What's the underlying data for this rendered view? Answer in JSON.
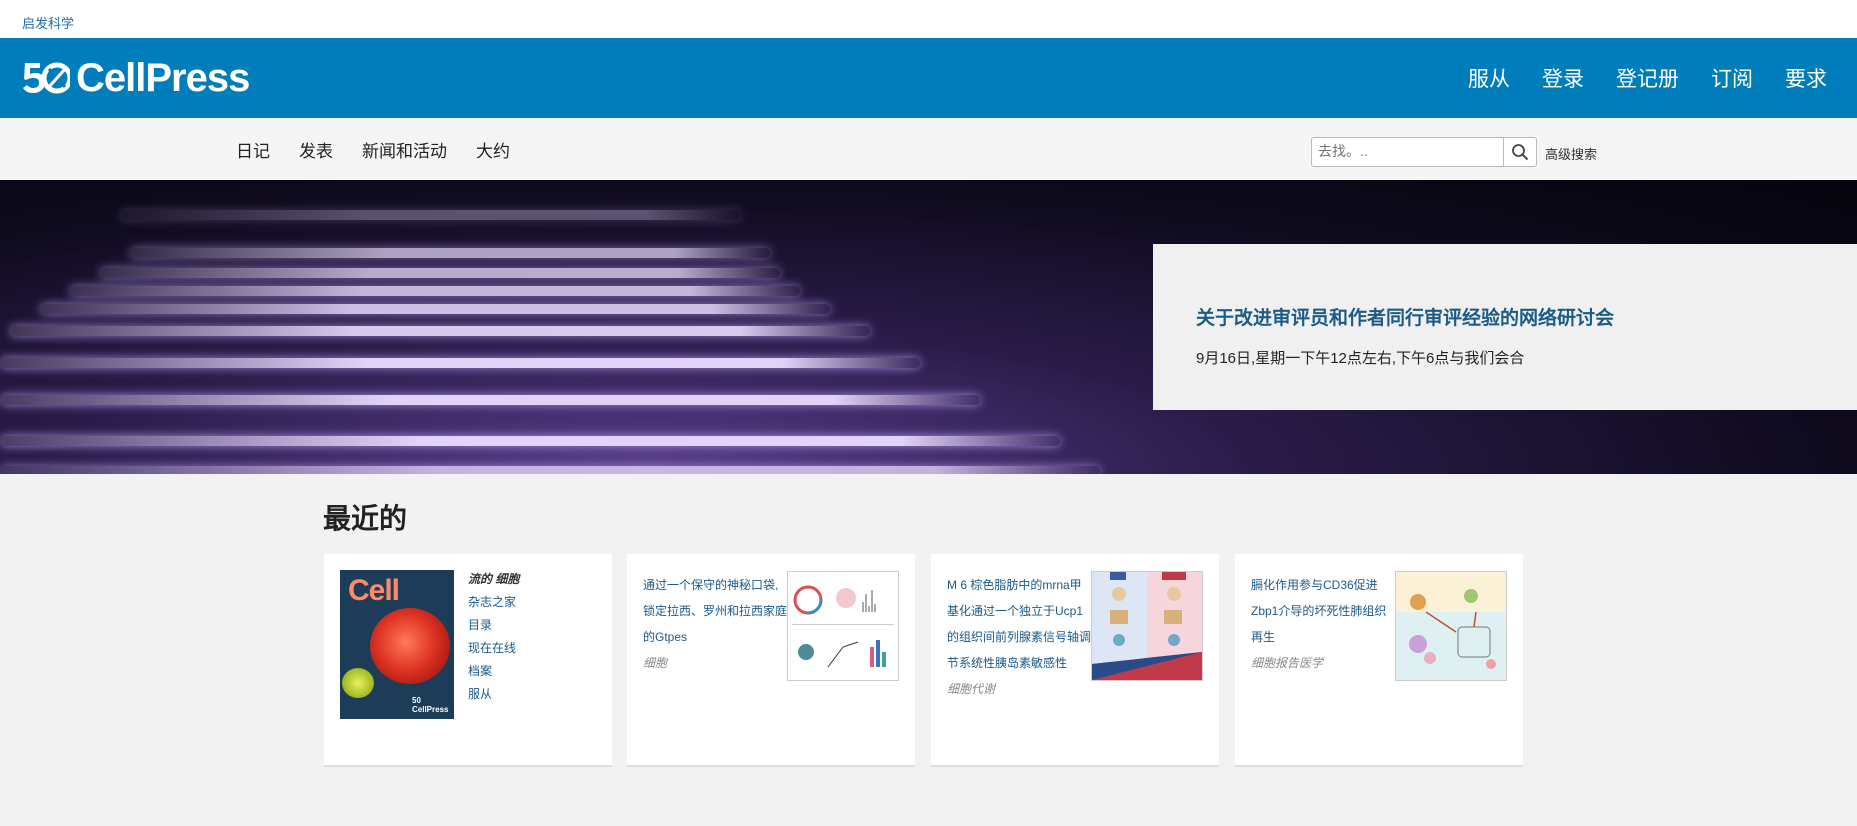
{
  "topbar": {
    "link": "启发科学"
  },
  "header": {
    "logo_number": "50",
    "logo_text": "CellPress",
    "nav": [
      "服从",
      "登录",
      "登记册",
      "订阅",
      "要求"
    ]
  },
  "subnav": {
    "items": [
      "日记",
      "发表",
      "新闻和活动",
      "大约"
    ],
    "search_placeholder": "去找。..",
    "advanced_search": "高级搜索"
  },
  "hero": {
    "title": "关于改进审评员和作者同行审评经验的网络研讨会",
    "subtitle": "9月16日,星期一下午12点左右,下午6点与我们会合"
  },
  "recent": {
    "heading": "最近的",
    "card1": {
      "cover_title": "Cell",
      "cover_brand": "50 CellPress",
      "links": [
        "流的 细胞",
        "杂志之家",
        "目录",
        "现在在线",
        "档案",
        "服从"
      ]
    },
    "articles": [
      {
        "title": "通过一个保守的神秘口袋,锁定拉西、罗州和拉西家庭的Gtpes",
        "journal": "细胞"
      },
      {
        "title": "M 6 棕色脂肪中的mrna甲基化通过一个独立于Ucp1的组织间前列腺素信号轴调节系统性胰岛素敏感性",
        "journal": "细胞代谢"
      },
      {
        "title": "膈化作用参与CD36促进Zbp1介导的坏死性肺组织再生",
        "journal": "细胞报告医学"
      }
    ]
  },
  "colors": {
    "brand": "#007dbb",
    "link": "#1a5a8a",
    "hero_title": "#1b5b85"
  }
}
